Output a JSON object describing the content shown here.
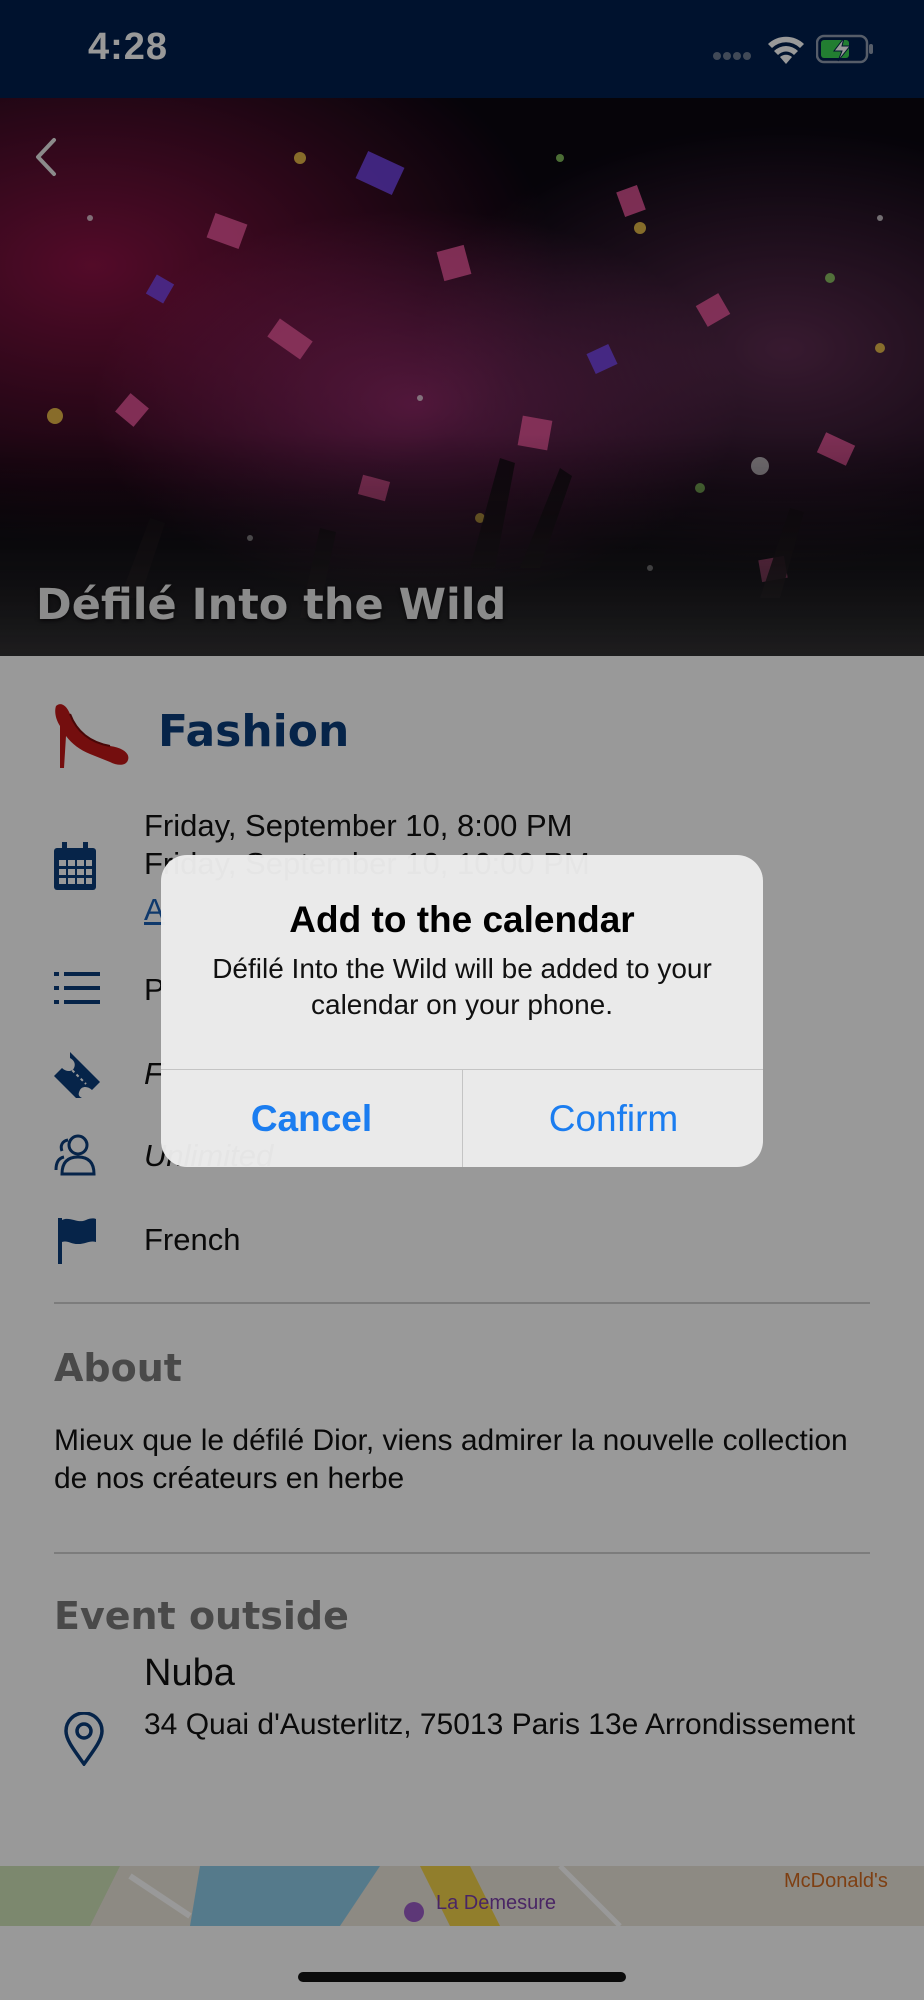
{
  "status_bar": {
    "time": "4:28"
  },
  "hero": {
    "title": "Défilé Into the Wild"
  },
  "category": {
    "label": "Fashion"
  },
  "details": {
    "date_start": "Friday, September 10, 8:00 PM",
    "date_end_partial": "Friday, September 10, 10:00 PM",
    "add_to_calendar_partial": "A",
    "list_partial": "P",
    "ticket_partial": "F",
    "capacity_partial": "Unlimited",
    "language": "French"
  },
  "about": {
    "title": "About",
    "text": "Mieux que le défilé Dior, viens admirer la nouvelle collection de nos créateurs en herbe"
  },
  "location": {
    "title": "Event outside",
    "venue": "Nuba",
    "address": "34 Quai d'Austerlitz, 75013 Paris 13e Arrondissement"
  },
  "map": {
    "label_demesure": "La Demesure",
    "label_mcdonalds": "McDonald's"
  },
  "dialog": {
    "title": "Add to the calendar",
    "message": "Défilé Into the Wild will be added to your calendar on your phone.",
    "cancel_label": "Cancel",
    "confirm_label": "Confirm"
  },
  "colors": {
    "status_bar": "#001f4d",
    "accent_blue": "#0a3d7a",
    "dialog_button": "#1b7df0"
  }
}
